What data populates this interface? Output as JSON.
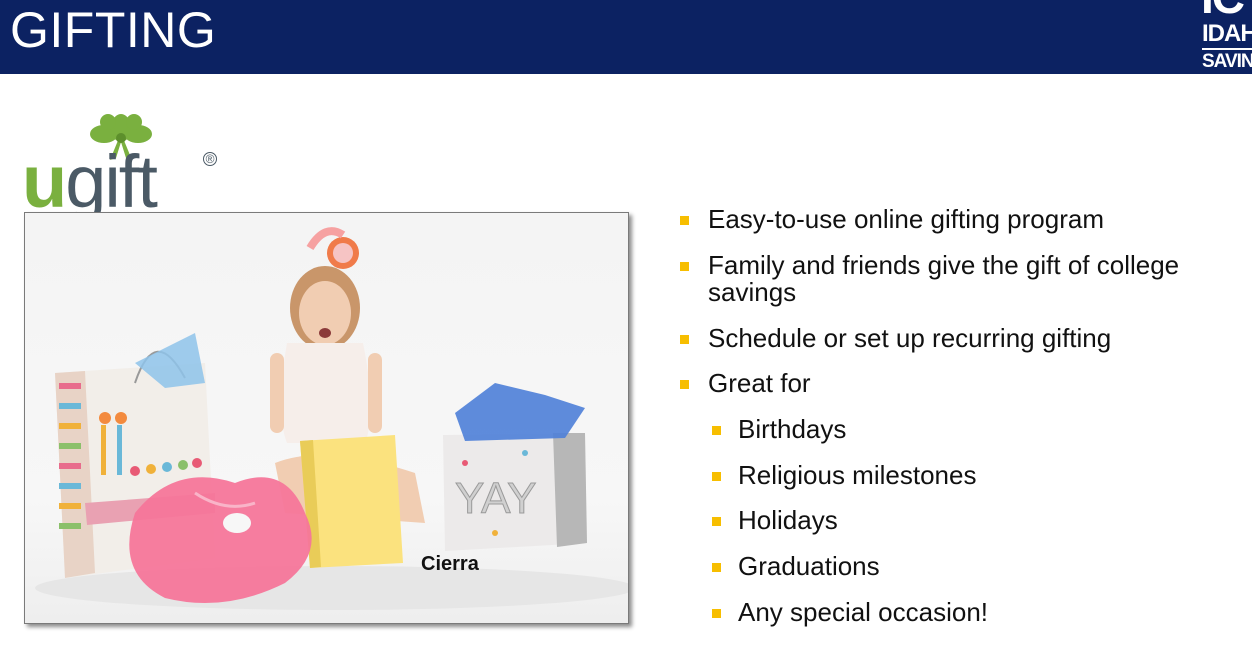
{
  "header": {
    "title": "GIFTING",
    "brand_mark": "IC",
    "brand_line1": "IDAHO",
    "brand_line2": "SAVINGS"
  },
  "logo": {
    "u": "u",
    "gift": "gift",
    "registered": "®"
  },
  "photo": {
    "caption": "Cierra"
  },
  "bullets": [
    {
      "text": "Easy-to-use online gifting program"
    },
    {
      "text": "Family and friends give the gift of college",
      "continuation": "savings"
    },
    {
      "text": "Schedule or set up recurring gifting"
    },
    {
      "text": "Great for"
    }
  ],
  "sub_bullets": [
    {
      "text": "Birthdays"
    },
    {
      "text": "Religious milestones"
    },
    {
      "text": "Holidays"
    },
    {
      "text": "Graduations"
    },
    {
      "text": "Any special occasion!"
    }
  ],
  "colors": {
    "header_bg": "#0c2262",
    "bullet_marker": "#f7be00",
    "logo_green": "#7ab03f",
    "logo_slate": "#4b5a66"
  }
}
